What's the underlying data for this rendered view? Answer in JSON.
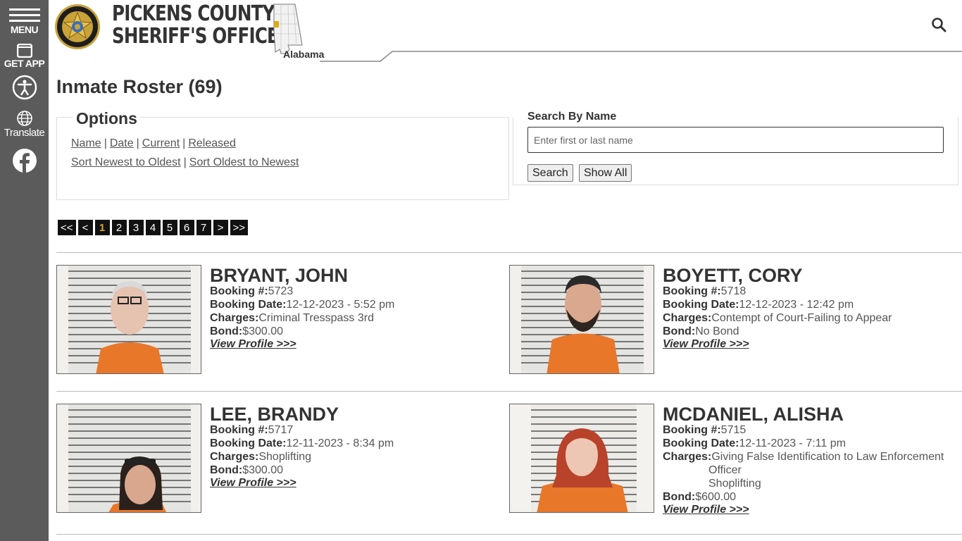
{
  "sidebar": {
    "menu_label": "MENU",
    "app_label": "GET APP",
    "translate_label": "Translate"
  },
  "header": {
    "brand_line1": "PICKENS COUNTY",
    "brand_line2": "SHERIFF'S OFFICE",
    "state": "Alabama",
    "badge_top": "PICKENS COUNTY",
    "badge_bottom": "SHERIFF'S OFFICE"
  },
  "page": {
    "title": "Inmate Roster (69)"
  },
  "options": {
    "legend": "Options",
    "filters": [
      "Name",
      "Date",
      "Current",
      "Released"
    ],
    "sort_newest": "Sort Newest to Oldest",
    "sort_oldest": "Sort Oldest to Newest",
    "separator": "|"
  },
  "search": {
    "legend": "Search By Name",
    "placeholder": "Enter first or last name",
    "value": "",
    "search_button": "Search",
    "show_all_button": "Show All"
  },
  "pagination": {
    "first": "<<",
    "prev": "<",
    "pages": [
      "1",
      "2",
      "3",
      "4",
      "5",
      "6",
      "7"
    ],
    "current": "1",
    "next": ">",
    "last": ">>"
  },
  "labels": {
    "booking": "Booking #:",
    "booking_date": "Booking Date:",
    "charges": "Charges:",
    "bond": "Bond:",
    "view_profile": "View Profile >>>"
  },
  "inmates": [
    {
      "name": "BRYANT, JOHN",
      "booking": "5723",
      "booking_date": "12-12-2023 - 5:52 pm",
      "charges": [
        "Criminal Tresspass 3rd"
      ],
      "bond": "$300.00"
    },
    {
      "name": "BOYETT, CORY",
      "booking": "5718",
      "booking_date": "12-12-2023 - 12:42 pm",
      "charges": [
        "Contempt of Court-Failing to Appear"
      ],
      "bond": "No Bond"
    },
    {
      "name": "LEE, BRANDY",
      "booking": "5717",
      "booking_date": "12-11-2023 - 8:34 pm",
      "charges": [
        "Shoplifting"
      ],
      "bond": "$300.00"
    },
    {
      "name": "MCDANIEL, ALISHA",
      "booking": "5715",
      "booking_date": "12-11-2023 - 7:11 pm",
      "charges": [
        "Giving False Identification to Law Enforcement",
        "Officer",
        "Shoplifting"
      ],
      "bond": "$600.00"
    }
  ],
  "colors": {
    "sidebar_bg": "#5b5b5b",
    "active_page": "#d9a521",
    "jumpsuit": "#e8772a"
  }
}
